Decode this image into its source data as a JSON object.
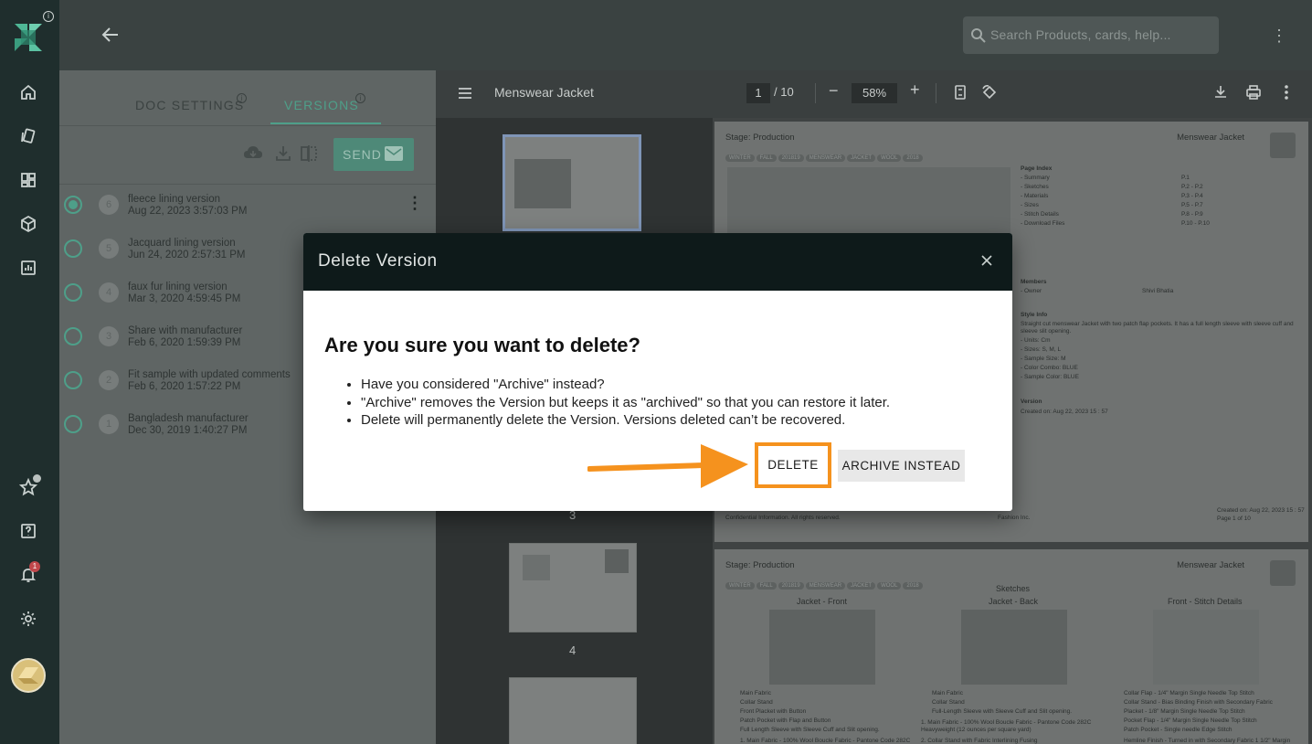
{
  "rail": {
    "notification_count": "1"
  },
  "search": {
    "placeholder": "Search Products, cards, help..."
  },
  "panel": {
    "tabs": [
      {
        "label": "DOC SETTINGS"
      },
      {
        "label": "VERSIONS"
      }
    ],
    "send_label": "SEND",
    "versions": [
      {
        "num": "6",
        "name": "fleece lining version",
        "date": "Aug 22, 2023 3:57:03 PM",
        "selected": true
      },
      {
        "num": "5",
        "name": "Jacquard lining version",
        "date": "Jun 24, 2020 2:57:31 PM"
      },
      {
        "num": "4",
        "name": "faux fur lining version",
        "date": "Mar 3, 2020 4:59:45 PM"
      },
      {
        "num": "3",
        "name": "Share with manufacturer",
        "date": "Feb 6, 2020 1:59:39 PM"
      },
      {
        "num": "2",
        "name": "Fit sample with updated comments",
        "date": "Feb 6, 2020 1:57:22 PM"
      },
      {
        "num": "1",
        "name": "Bangladesh manufacturer",
        "date": "Dec 30, 2019 1:40:27 PM"
      }
    ]
  },
  "viewer": {
    "title": "Menswear Jacket",
    "page_current": "1",
    "page_total": "/ 10",
    "zoom": "58%",
    "thumb_labels": [
      "3",
      "4"
    ]
  },
  "doc_page1": {
    "stage": "Stage: Production",
    "name": "Menswear Jacket",
    "tags": [
      "WINTER",
      "FALL",
      "201819",
      "MENSWEAR",
      "JACKET",
      "WOOL",
      "2018"
    ],
    "index_title": "Page Index",
    "index": [
      [
        "- Summary",
        "P.1"
      ],
      [
        "- Sketches",
        "P.2 - P.2"
      ],
      [
        "- Materials",
        "P.3 - P.4"
      ],
      [
        "- Sizes",
        "P.5 - P.7"
      ],
      [
        "- Stitch Details",
        "P.8 - P.9"
      ],
      [
        "- Download Files",
        "P.10 - P.10"
      ]
    ],
    "members_title": "Members",
    "owner_label": "- Owner",
    "owner_value": "Shivi Bhatia",
    "style_title": "Style Info",
    "style_desc_1": "Straight cut menswear Jacket with two patch flap pockets. It has a full length sleeve with sleeve cuff and",
    "style_desc_2": "sleeve slit opening.",
    "style_items": [
      "- Units: Cm",
      "- Sizes: S, M, L",
      "- Sample Size: M",
      "- Color Combo: BLUE",
      "- Sample Color: BLUE"
    ],
    "version_title": "Version",
    "created_on": "Created on: Aug 22, 2023 15 : 57",
    "footer_left": "Confidential Information. All rights reserved.",
    "footer_center": "Fashion Inc.",
    "footer_right_1": "Created on: Aug 22, 2023 15 : 57",
    "footer_right_2": "Page 1 of 10"
  },
  "doc_page2": {
    "stage": "Stage: Production",
    "name": "Menswear Jacket",
    "tags": [
      "WINTER",
      "FALL",
      "201819",
      "MENSWEAR",
      "JACKET",
      "WOOL",
      "2018"
    ],
    "section": "Sketches",
    "columns": [
      "Jacket - Front",
      "Jacket - Back",
      "Front - Stitch Details"
    ],
    "col1_items": [
      "Main Fabric",
      "Collar Stand",
      "Front Placket with Button",
      "Patch Pocket with Flap and Button",
      "Full Length Sleeve with Sleeve Cuff and Slit opening."
    ],
    "col1_note": "1. Main Fabric - 100% Wool Boucle Fabric - Pantone Code 282C",
    "col2_items": [
      "Main Fabric",
      "Collar Stand",
      "Full-Length Sleeve with Sleeve Cuff and Slit opening."
    ],
    "col2_note_1": "1. Main Fabric - 100% Wool Boucle Fabric - Pantone Code 282C",
    "col2_note_2": "Heavyweight (12 ounces per square yard)",
    "col2_note_3": "2. Collar Stand with Fabric Interlining Fusing",
    "col3_items": [
      "Collar Flap - 1/4\" Margin Single Needle Top Stitch",
      "Collar Stand - Bias Binding Finish with Secondary Fabric",
      "Placket - 1/8\" Margin Single Needle Top Stitch",
      "Pocket Flap - 1/4\" Margin Single Needle Top Stitch",
      "Patch Pocket - Single needle Edge Stitch",
      "Hemline Finish - Turned in with Secondary Fabric 1 1/2\" Margin"
    ]
  },
  "dialog": {
    "title": "Delete Version",
    "question": "Are you sure you want to delete?",
    "bullets": [
      "Have you considered \"Archive\" instead?",
      "\"Archive\" removes the Version but keeps it as \"archived\" so that you can restore it later.",
      "Delete will permanently delete the Version. Versions deleted can’t be recovered."
    ],
    "delete_label": "DELETE",
    "archive_label": "ARCHIVE INSTEAD"
  },
  "colors": {
    "accent": "#4e9f89",
    "highlight": "#f5921e"
  }
}
